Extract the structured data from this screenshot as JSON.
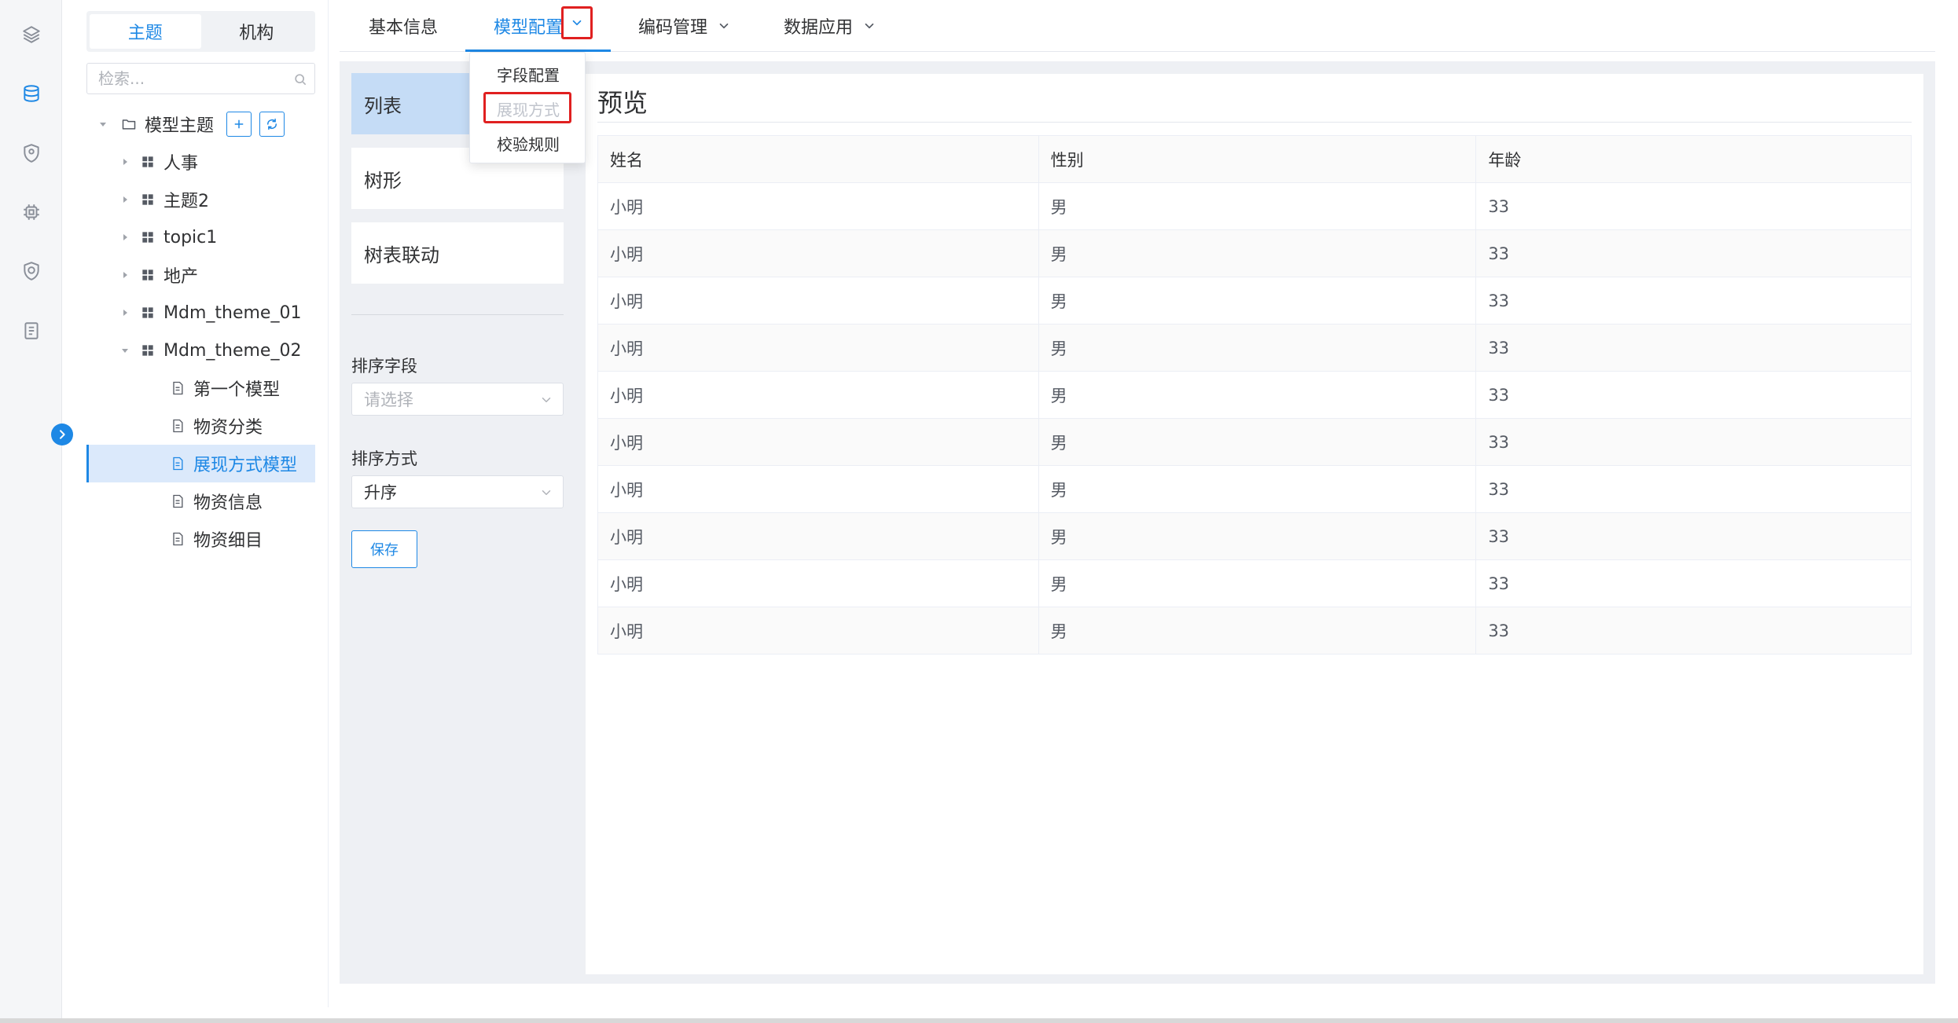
{
  "segment": {
    "tabs": [
      "主题",
      "机构"
    ],
    "active": "主题"
  },
  "search": {
    "placeholder": "检索..."
  },
  "tree": {
    "root": {
      "label": "模型主题"
    },
    "themes": [
      {
        "label": "人事"
      },
      {
        "label": "主题2"
      },
      {
        "label": "topic1"
      },
      {
        "label": "地产"
      },
      {
        "label": "Mdm_theme_01"
      },
      {
        "label": "Mdm_theme_02"
      }
    ],
    "models": [
      {
        "label": "第一个模型"
      },
      {
        "label": "物资分类"
      },
      {
        "label": "展现方式模型"
      },
      {
        "label": "物资信息"
      },
      {
        "label": "物资细目"
      }
    ],
    "selected": "展现方式模型"
  },
  "top_tabs": [
    {
      "label": "基本信息"
    },
    {
      "label": "模型配置"
    },
    {
      "label": "编码管理"
    },
    {
      "label": "数据应用"
    }
  ],
  "active_tab": "模型配置",
  "dropdown": {
    "items": [
      {
        "label": "字段配置",
        "disabled": false
      },
      {
        "label": "展现方式",
        "disabled": true
      },
      {
        "label": "校验规则",
        "disabled": false
      }
    ]
  },
  "layouts": [
    {
      "label": "列表",
      "active": true
    },
    {
      "label": "树形",
      "active": false
    },
    {
      "label": "树表联动",
      "active": false
    }
  ],
  "sort_field": {
    "label": "排序字段",
    "placeholder": "请选择"
  },
  "sort_order": {
    "label": "排序方式",
    "value": "升序"
  },
  "save_label": "保存",
  "preview": {
    "title": "预览",
    "columns": [
      "姓名",
      "性别",
      "年龄"
    ],
    "rows": [
      [
        "小明",
        "男",
        "33"
      ],
      [
        "小明",
        "男",
        "33"
      ],
      [
        "小明",
        "男",
        "33"
      ],
      [
        "小明",
        "男",
        "33"
      ],
      [
        "小明",
        "男",
        "33"
      ],
      [
        "小明",
        "男",
        "33"
      ],
      [
        "小明",
        "男",
        "33"
      ],
      [
        "小明",
        "男",
        "33"
      ],
      [
        "小明",
        "男",
        "33"
      ],
      [
        "小明",
        "男",
        "33"
      ]
    ]
  },
  "colors": {
    "primary": "#1e88e5",
    "highlight": "#e02020",
    "selected_bg": "#dbe9fb",
    "active_card": "#c5dcf6"
  },
  "icons": {
    "rail": [
      "layers-icon",
      "database-icon",
      "shield-pin-icon",
      "chip-icon",
      "shield-check-icon",
      "document-list-icon"
    ]
  }
}
